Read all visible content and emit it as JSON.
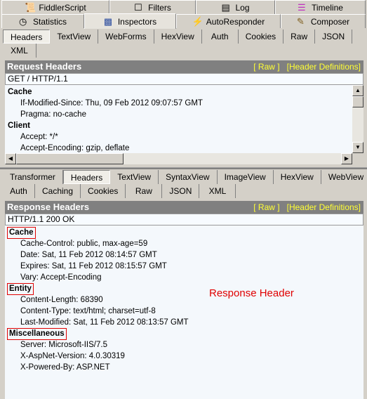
{
  "main_tabs_row1": [
    {
      "label": "FiddlerScript",
      "icon": "script-icon"
    },
    {
      "label": "Filters",
      "icon": "checkbox-icon"
    },
    {
      "label": "Log",
      "icon": "document-icon"
    },
    {
      "label": "Timeline",
      "icon": "timeline-icon"
    }
  ],
  "main_tabs_row2": [
    {
      "label": "Statistics",
      "icon": "stopwatch-icon"
    },
    {
      "label": "Inspectors",
      "icon": "inspectors-icon",
      "active": true
    },
    {
      "label": "AutoResponder",
      "icon": "lightning-icon"
    },
    {
      "label": "Composer",
      "icon": "composer-icon"
    }
  ],
  "request": {
    "tabs_row1": [
      "Headers",
      "TextView",
      "WebForms",
      "HexView",
      "Auth",
      "Cookies",
      "Raw",
      "JSON"
    ],
    "tabs_row2": [
      "XML"
    ],
    "active_tab": "Headers",
    "title": "Request Headers",
    "raw_link": "[ Raw ]",
    "defs_link": "[Header Definitions]",
    "first_line": "GET / HTTP/1.1",
    "groups": [
      {
        "name": "Cache",
        "items": [
          "If-Modified-Since: Thu, 09 Feb 2012 09:07:57 GMT",
          "Pragma: no-cache"
        ]
      },
      {
        "name": "Client",
        "items": [
          "Accept: */*",
          "Accept-Encoding: gzip, deflate"
        ]
      }
    ]
  },
  "response": {
    "tabs_row1": [
      "Transformer",
      "Headers",
      "TextView",
      "SyntaxView",
      "ImageView",
      "HexView",
      "WebView"
    ],
    "tabs_row2": [
      "Auth",
      "Caching",
      "Cookies",
      "Raw",
      "JSON",
      "XML"
    ],
    "active_tab": "Headers",
    "title": "Response Headers",
    "raw_link": "[ Raw ]",
    "defs_link": "[Header Definitions]",
    "first_line": "HTTP/1.1 200 OK",
    "groups": [
      {
        "name": "Cache",
        "items": [
          "Cache-Control: public, max-age=59",
          "Date: Sat, 11 Feb 2012 08:14:57 GMT",
          "Expires: Sat, 11 Feb 2012 08:15:57 GMT",
          "Vary: Accept-Encoding"
        ]
      },
      {
        "name": "Entity",
        "items": [
          "Content-Length: 68390",
          "Content-Type: text/html; charset=utf-8",
          "Last-Modified: Sat, 11 Feb 2012 08:13:57 GMT"
        ]
      },
      {
        "name": "Miscellaneous",
        "items": [
          "Server: Microsoft-IIS/7.5",
          "X-AspNet-Version: 4.0.30319",
          "X-Powered-By: ASP.NET"
        ]
      }
    ],
    "annotation": "Response Header",
    "annotation_color": "#e00000"
  }
}
